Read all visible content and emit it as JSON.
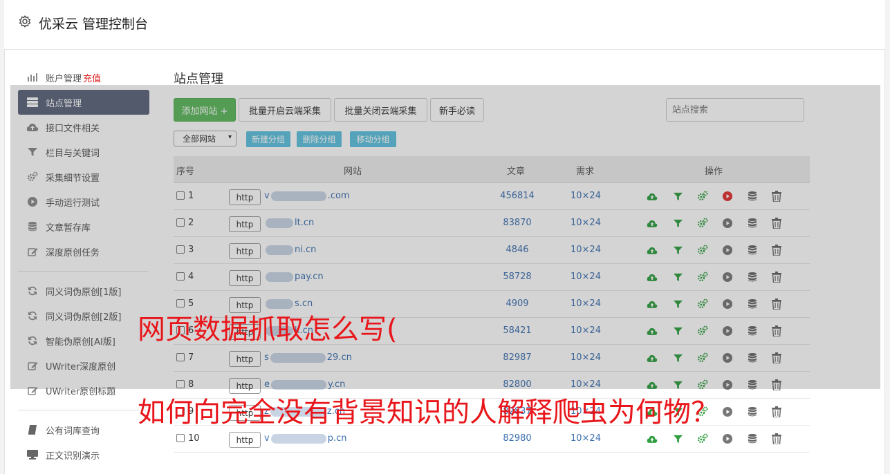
{
  "header": {
    "title": "优采云 管理控制台",
    "icon": "gear-icon"
  },
  "sidebar": {
    "groups": [
      [
        {
          "label": "账户管理",
          "badge": "充值",
          "icon": "bar-chart-icon"
        },
        {
          "label": "站点管理",
          "icon": "server-icon",
          "active": true
        },
        {
          "label": "接口文件相关",
          "icon": "cloud-upload-icon"
        },
        {
          "label": "栏目与关键词",
          "icon": "filter-icon"
        },
        {
          "label": "采集细节设置",
          "icon": "cogs-icon"
        },
        {
          "label": "手动运行测试",
          "icon": "play-circle-icon"
        },
        {
          "label": "文章暂存库",
          "icon": "database-icon"
        },
        {
          "label": "深度原创任务",
          "icon": "edit-icon"
        }
      ],
      [
        {
          "label": "同义词伪原创[1版]",
          "icon": "refresh-icon"
        },
        {
          "label": "同义词伪原创[2版]",
          "icon": "refresh-icon"
        },
        {
          "label": "智能伪原创[AI版]",
          "icon": "refresh-icon"
        },
        {
          "label": "UWriter深度原创",
          "icon": "edit-icon"
        },
        {
          "label": "UWriter原创标题",
          "icon": "edit-icon"
        }
      ],
      [
        {
          "label": "公有词库查询",
          "icon": "book-icon"
        },
        {
          "label": "正文识别演示",
          "icon": "monitor-icon"
        }
      ]
    ]
  },
  "main": {
    "title": "站点管理",
    "toolbar": {
      "add_site": "添加网站 +",
      "batch_enable": "批量开启云端采集",
      "batch_disable": "批量关闭云端采集",
      "newbie": "新手必读",
      "search_placeholder": "站点搜索"
    },
    "group_select": "全部网站",
    "group_buttons": {
      "new": "新建分组",
      "delete": "删除分组",
      "move": "移动分组"
    },
    "table": {
      "headers": {
        "index": "序号",
        "site": "网站",
        "articles": "文章",
        "demand": "需求",
        "actions": "操作"
      },
      "rows": [
        {
          "num": "1",
          "protocol": "http",
          "site_prefix": "v",
          "site_suffix": ".com",
          "articles": "456814",
          "demand": "10×24",
          "active": true
        },
        {
          "num": "2",
          "protocol": "http",
          "site_prefix": "",
          "site_suffix": "lt.cn",
          "articles": "83870",
          "demand": "10×24",
          "active": false
        },
        {
          "num": "3",
          "protocol": "http",
          "site_prefix": "",
          "site_suffix": "ni.cn",
          "articles": "4846",
          "demand": "10×24",
          "active": false
        },
        {
          "num": "4",
          "protocol": "http",
          "site_prefix": "",
          "site_suffix": "pay.cn",
          "articles": "58728",
          "demand": "10×24",
          "active": false
        },
        {
          "num": "5",
          "protocol": "http",
          "site_prefix": "",
          "site_suffix": "s.cn",
          "articles": "4909",
          "demand": "10×24",
          "active": false
        },
        {
          "num": "6",
          "protocol": "http",
          "site_prefix": "",
          "site_suffix": "k.cn",
          "articles": "58421",
          "demand": "10×24",
          "active": false
        },
        {
          "num": "7",
          "protocol": "http",
          "site_prefix": "s",
          "site_suffix": "29.cn",
          "articles": "82987",
          "demand": "10×24",
          "active": false
        },
        {
          "num": "8",
          "protocol": "http",
          "site_prefix": "e",
          "site_suffix": "y.cn",
          "articles": "82800",
          "demand": "10×24",
          "active": false
        },
        {
          "num": "9",
          "protocol": "http",
          "site_prefix": "z",
          "site_suffix": "z.cn",
          "articles": "82837",
          "demand": "10×24",
          "active": false
        },
        {
          "num": "10",
          "protocol": "http",
          "site_prefix": "v",
          "site_suffix": "p.cn",
          "articles": "82980",
          "demand": "10×24",
          "active": false
        }
      ]
    }
  },
  "overlay_text": {
    "line1": "网页数据抓取怎么写(",
    "line2": "如何向完全没有背景知识的人解释爬虫为何物？"
  },
  "colors": {
    "accent_green": "#5cb85c",
    "info_blue": "#5bc0de",
    "link_blue": "#3a6fb0",
    "headline_red": "#e8161b",
    "active_nav": "#59637a"
  }
}
